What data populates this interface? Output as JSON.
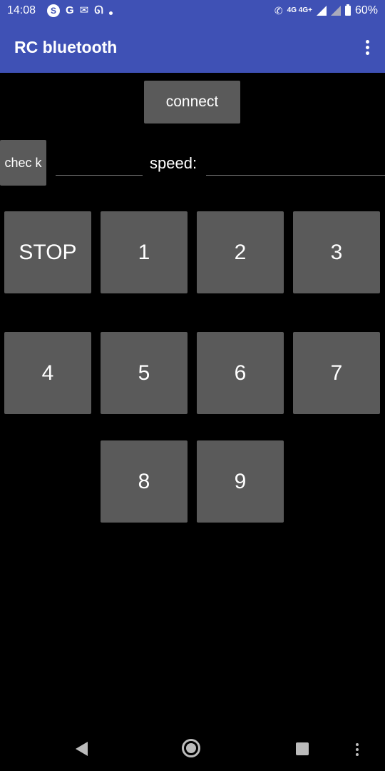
{
  "status_bar": {
    "time": "14:08",
    "network_label": "4G 4G+",
    "battery_percent": "60%",
    "icons": [
      "skype-icon",
      "google-icon",
      "gmail-icon",
      "swirl-icon",
      "notification-dot-icon",
      "volte-icon",
      "signal-icon",
      "signal-icon",
      "battery-icon"
    ]
  },
  "app_bar": {
    "title": "RC bluetooth",
    "menu_icon": "overflow-menu-icon"
  },
  "controls": {
    "connect_label": "connect",
    "check_label": "chec k",
    "speed_label": "speed:",
    "left_input_value": "",
    "speed_input_value": ""
  },
  "pad_buttons": [
    "STOP",
    "1",
    "2",
    "3",
    "4",
    "5",
    "6",
    "7",
    "8",
    "9"
  ],
  "nav_bar": {
    "icons": [
      "back-icon",
      "home-icon",
      "recents-icon",
      "more-icon"
    ]
  },
  "colors": {
    "primary": "#3f51b5",
    "background": "#000000",
    "button": "#5a5a5a"
  }
}
